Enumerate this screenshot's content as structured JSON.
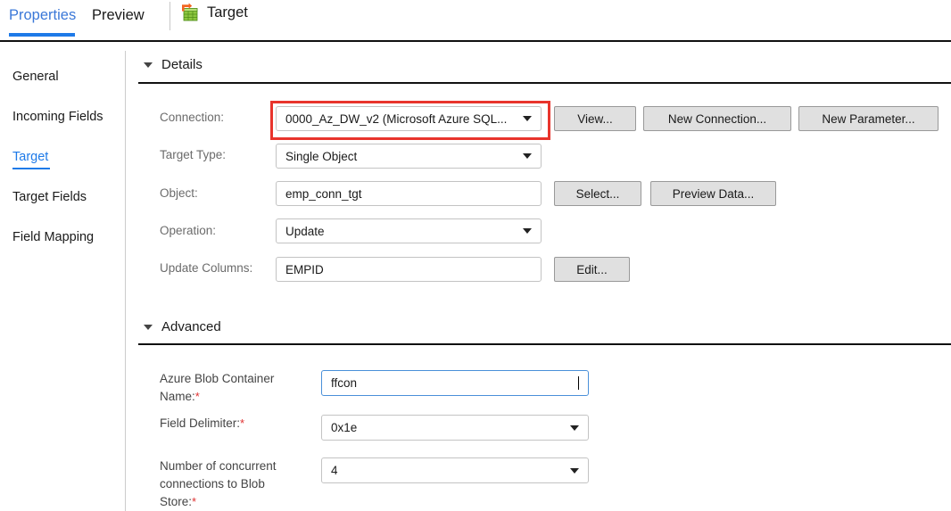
{
  "tabbar": {
    "tabs": [
      {
        "label": "Properties",
        "active": true
      },
      {
        "label": "Preview",
        "active": false
      }
    ],
    "target_tab": {
      "label": "Target",
      "icon": "target-table-icon"
    }
  },
  "sidebar": {
    "items": [
      {
        "label": "General",
        "active": false
      },
      {
        "label": "Incoming Fields",
        "active": false
      },
      {
        "label": "Target",
        "active": true
      },
      {
        "label": "Target Fields",
        "active": false
      },
      {
        "label": "Field Mapping",
        "active": false
      }
    ]
  },
  "details": {
    "section_title": "Details",
    "connection": {
      "label": "Connection:",
      "value": "0000_Az_DW_v2 (Microsoft Azure SQL...",
      "highlighted": true,
      "highlight_color": "#e8342c"
    },
    "target_type": {
      "label": "Target Type:",
      "value": "Single Object"
    },
    "object": {
      "label": "Object:",
      "value": "emp_conn_tgt"
    },
    "operation": {
      "label": "Operation:",
      "value": "Update"
    },
    "update_columns": {
      "label": "Update Columns:",
      "value": "EMPID"
    },
    "buttons": {
      "view": "View...",
      "new_connection": "New Connection...",
      "new_parameter": "New Parameter...",
      "select": "Select...",
      "preview_data": "Preview Data...",
      "edit": "Edit..."
    }
  },
  "advanced": {
    "section_title": "Advanced",
    "blob_container": {
      "label_line1": "Azure Blob Container",
      "label_line2": "Name:",
      "required": "*",
      "value": "ffcon",
      "focused": true
    },
    "field_delimiter": {
      "label": "Field Delimiter:",
      "required": "*",
      "value": "0x1e"
    },
    "concurrent_connections": {
      "label_line1": "Number of concurrent",
      "label_line2": "connections to Blob",
      "label_line3": "Store:",
      "required": "*",
      "value": "4"
    }
  },
  "colors": {
    "accent_blue": "#1e7ae8",
    "tab_blue": "#3b78d8",
    "highlight_red": "#e8342c",
    "required_red": "#e03131",
    "label_gray": "#6b6b6b",
    "button_face": "#e0e0e0"
  }
}
